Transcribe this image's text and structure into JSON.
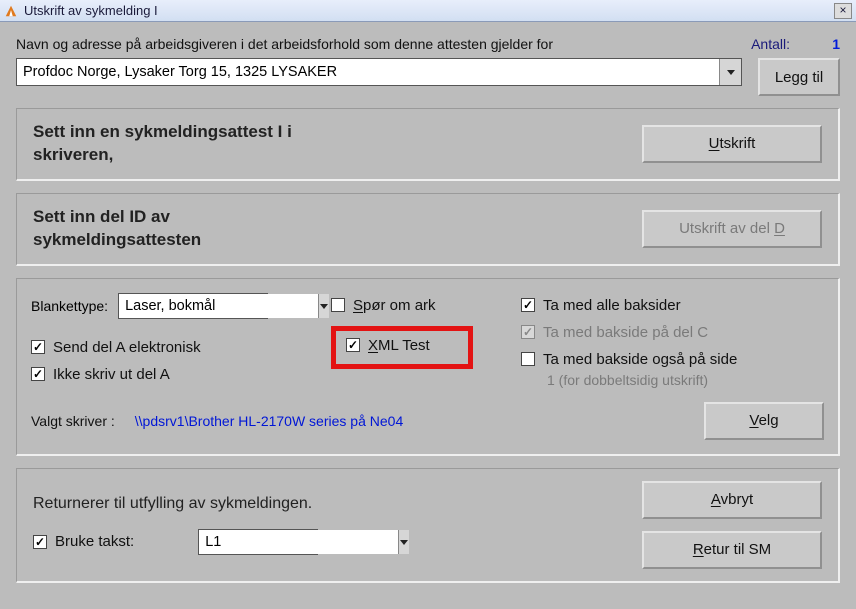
{
  "window": {
    "title": "Utskrift av sykmelding I"
  },
  "header": {
    "navn_label": "Navn og adresse på arbeidsgiveren i det arbeidsforhold som denne attesten gjelder for",
    "antall_label": "Antall:",
    "antall_value": "1",
    "address_value": "Profdoc Norge, Lysaker Torg 15, 1325 LYSAKER",
    "legg_til": "Legg til"
  },
  "panel1": {
    "title_l1": "Sett inn en sykmeldingsattest I i",
    "title_l2": "skriveren,",
    "button": "Utskrift",
    "button_uchar": "U"
  },
  "panel2": {
    "title_l1": "Sett inn del ID av",
    "title_l2": "sykmeldingsattesten",
    "button": "Utskrift av del D",
    "button_uchar": "D"
  },
  "opts": {
    "blankettype_label": "Blankettype:",
    "blankettype_value": "Laser, bokmål",
    "spor_om_ark": "Spør om ark",
    "send_del_a": "Send del A elektronisk",
    "ikke_skriv": "Ikke skriv ut del A",
    "xml_test": "XML Test",
    "ta_med_alle": "Ta med alle baksider",
    "ta_med_c": "Ta med bakside på del C",
    "ta_med_side1": "Ta med bakside også på side",
    "side1_note": "1 (for dobbeltsidig utskrift)",
    "valgt_skriver_label": "Valgt skriver :",
    "valgt_skriver_value": "\\\\pdsrv1\\Brother HL-2170W series på Ne04",
    "velg": "Velg"
  },
  "returnp": {
    "line1": "Returnerer til utfylling av sykmeldingen.",
    "bruke_takst": "Bruke takst:",
    "takst_value": "L1",
    "avbryt": "Avbryt",
    "retur": "Retur til SM"
  }
}
